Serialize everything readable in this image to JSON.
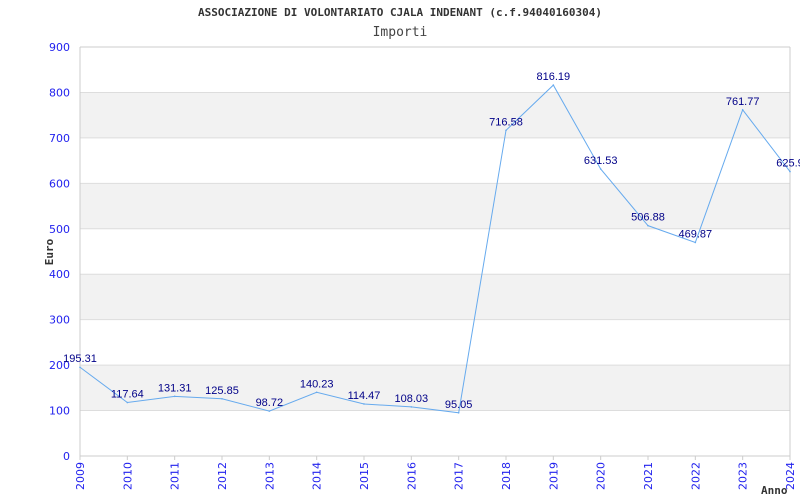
{
  "chart_data": {
    "type": "line",
    "title": "ASSOCIAZIONE DI VOLONTARIATO CJALA INDENANT (c.f.94040160304)",
    "subtitle": "Importi",
    "xlabel": "Anno",
    "ylabel": "Euro",
    "ylim": [
      0,
      900
    ],
    "yticks": [
      "0",
      "100",
      "200",
      "300",
      "400",
      "500",
      "600",
      "700",
      "800",
      "900"
    ],
    "categories": [
      "2009",
      "2010",
      "2011",
      "2012",
      "2013",
      "2014",
      "2015",
      "2016",
      "2017",
      "2018",
      "2019",
      "2020",
      "2021",
      "2022",
      "2023",
      "2024"
    ],
    "values": [
      195.31,
      117.64,
      131.31,
      125.85,
      98.72,
      140.23,
      114.47,
      108.03,
      95.05,
      716.58,
      816.19,
      631.53,
      506.88,
      469.87,
      761.77,
      625.9
    ],
    "labels": [
      "195.31",
      "117.64",
      "131.31",
      "125.85",
      "98.72",
      "140.23",
      "114.47",
      "108.03",
      "95.05",
      "716.58",
      "816.19",
      "631.53",
      "506.88",
      "469.87",
      "761.77",
      "625.9"
    ],
    "grid": true,
    "line_color": "#66aaee",
    "band_color": "#f2f2f2"
  }
}
